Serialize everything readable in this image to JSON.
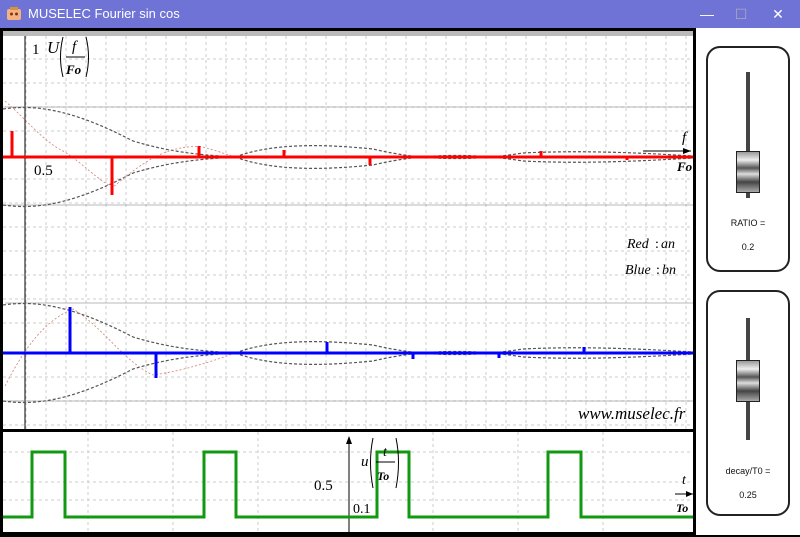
{
  "window": {
    "title": "MUSELEC Fourier sin cos",
    "minimize_glyph": "—",
    "maximize_glyph": "☐",
    "close_glyph": "✕"
  },
  "spectrum_plot": {
    "y_tick_top": "1",
    "y_tick_half": "0.5",
    "y_label_main": "U",
    "y_label_num": "f",
    "y_label_den": "Fo",
    "x_label_num": "f",
    "x_label_den": "Fo",
    "legend_red_name": "Red",
    "legend_red_coef": "an",
    "legend_blue_name": "Blue",
    "legend_blue_coef": "bn",
    "website": "www.muselec.fr",
    "red_color": "#ff0000",
    "blue_color": "#0000ff",
    "envelope_color": "#555555"
  },
  "time_plot": {
    "y_tick_half": "0.5",
    "y_tick_small": "0.1",
    "y_label_main": "u",
    "y_label_num": "t",
    "y_label_den": "To",
    "x_label_num": "t",
    "x_label_den": "To",
    "signal_color": "#119911"
  },
  "controls": {
    "ratio": {
      "label": "RATIO =",
      "value": "0.2",
      "level": 0.2
    },
    "decay": {
      "label": "decay/T0 =",
      "value": "0.25",
      "level": 0.25
    }
  }
}
